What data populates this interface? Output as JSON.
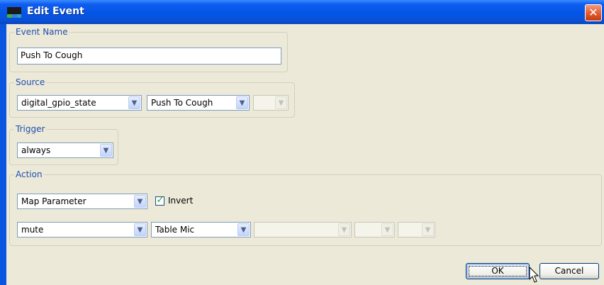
{
  "window": {
    "title": "Edit Event",
    "close_glyph": "✕",
    "colors": {
      "titlebar": "#0356e6",
      "client": "#ece9d8",
      "legend": "#1f4fb0"
    }
  },
  "event_name": {
    "legend": "Event Name",
    "value": "Push To Cough"
  },
  "source": {
    "legend": "Source",
    "type_value": "digital_gpio_state",
    "input_value": "Push To Cough",
    "extra_value": ""
  },
  "trigger": {
    "legend": "Trigger",
    "value": "always"
  },
  "action": {
    "legend": "Action",
    "action_value": "Map Parameter",
    "invert_label": "Invert",
    "invert_checked": true,
    "parameter_value": "mute",
    "target_value": "Table Mic",
    "extra1_value": "",
    "extra2_value": "",
    "extra3_value": ""
  },
  "buttons": {
    "ok_label": "OK",
    "cancel_label": "Cancel"
  },
  "icons": {
    "dropdown": "chevron-down-icon",
    "check": "checkmark-icon",
    "close": "close-icon",
    "app": "app-icon"
  }
}
